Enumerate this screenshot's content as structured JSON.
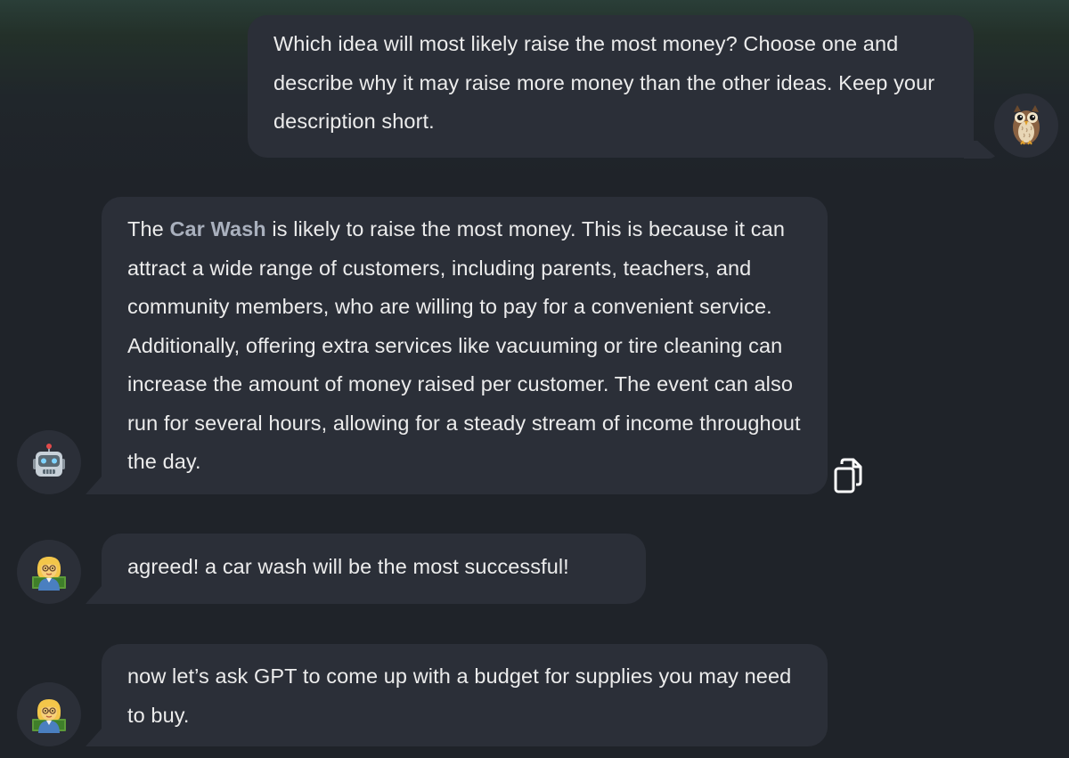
{
  "messages": {
    "user_question": {
      "text": "Which idea will most likely raise the most money? Choose one and describe why it may raise more money than the other ideas. Keep your description short.",
      "avatar_icon": "owl-icon"
    },
    "assistant_reply": {
      "prefix": "The ",
      "highlight": "Car Wash",
      "rest": " is likely to raise the most money. This is because it can attract a wide range of customers, including parents, teachers, and community members, who are willing to pay for a convenient service. Additionally, offering extra services like vacuuming or tire cleaning can increase the amount of money raised per customer. The event can also run for several hours, allowing for a steady stream of income throughout the day.",
      "avatar_icon": "robot-icon",
      "copy_icon": "copy-icon"
    },
    "teacher_reply_1": {
      "text": "agreed! a car wash will be the most successful!",
      "avatar_icon": "teacher-icon"
    },
    "teacher_reply_2": {
      "text": "now let’s ask GPT to come up with a budget for supplies you may need to buy.",
      "avatar_icon": "teacher-icon"
    }
  },
  "colors": {
    "background": "#1f2329",
    "bubble": "#2b2f38",
    "text": "#ececec",
    "highlight": "#a9b0bd"
  }
}
